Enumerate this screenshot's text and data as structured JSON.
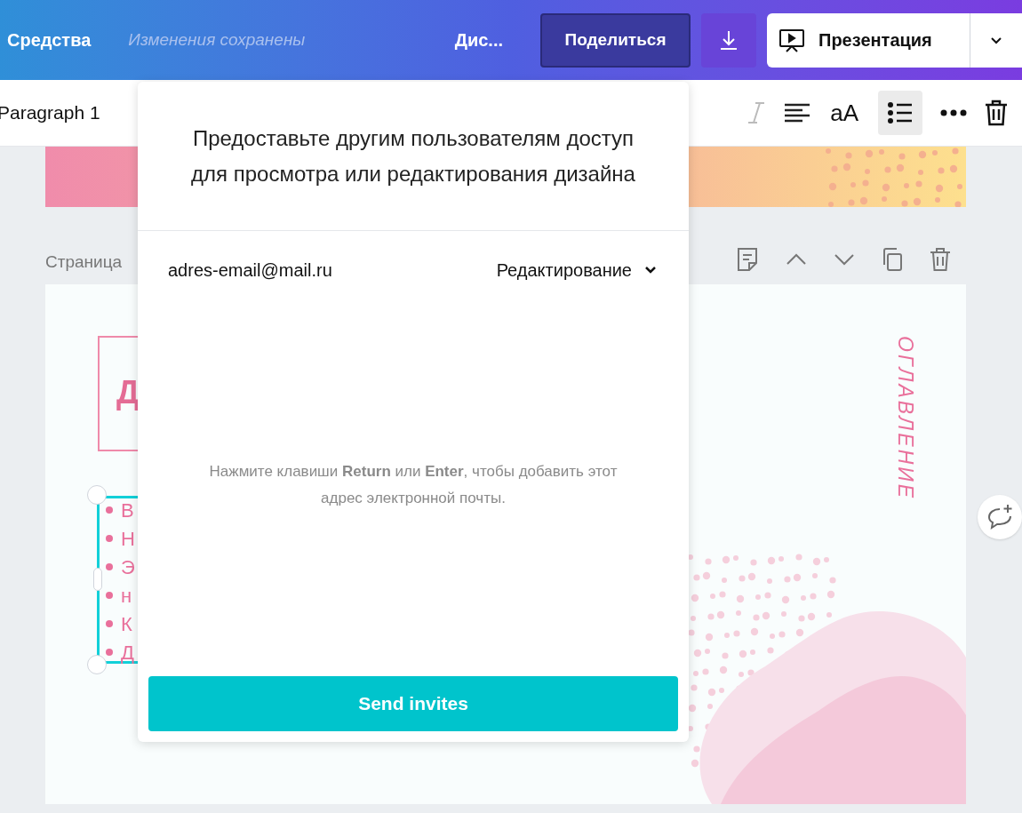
{
  "top_bar": {
    "menu_label": "Средства",
    "save_status": "Изменения сохранены",
    "design_title": "Дис...",
    "share_button": {
      "label": "Поделиться",
      "selected": true
    },
    "present_button": "Презентация"
  },
  "text_toolbar": {
    "style_label": "Paragraph 1",
    "case_button": "aA",
    "list_button": {
      "selected": true
    }
  },
  "page": {
    "label": "Страница",
    "title_text": "Д",
    "bullets": [
      "В",
      "Н",
      "Э",
      "н",
      "К",
      "Д"
    ],
    "side_title": "ОГЛАВЛЕНИЕ"
  },
  "share_dialog": {
    "title": "Предоставьте другим пользователям доступ для просмотра или редактирования дизайна",
    "email": "adres-email@mail.ru",
    "permission": "Редактирование",
    "hint": "Нажмите клавиши **Return** или **Enter**, чтобы добавить этот адрес электронной почты.",
    "send_button": "Send invites"
  }
}
